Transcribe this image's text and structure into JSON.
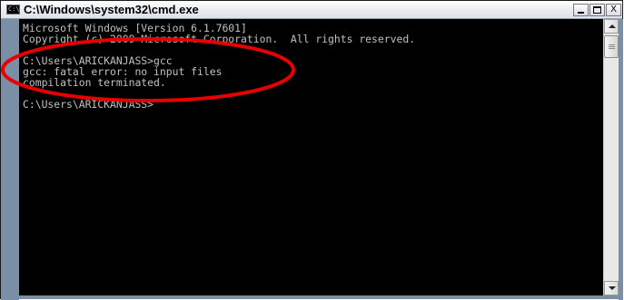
{
  "window": {
    "title": "C:\\Windows\\system32\\cmd.exe",
    "icon": "cmd-icon",
    "icon_text": "C:\\"
  },
  "controls": {
    "minimize": "minimize-icon",
    "maximize": "maximize-icon",
    "close": "close-icon",
    "close_glyph": "X"
  },
  "console": {
    "lines": [
      "Microsoft Windows [Version 6.1.7601]",
      "Copyright (c) 2009 Microsoft Corporation.  All rights reserved.",
      "",
      "C:\\Users\\ARICKANJASS>gcc",
      "gcc: fatal error: no input files",
      "compilation terminated.",
      "",
      "C:\\Users\\ARICKANJASS>"
    ]
  },
  "annotation": {
    "color": "#e60000"
  },
  "colors": {
    "console_bg": "#000000",
    "console_text": "#c0c0c0",
    "frame": "#7a8fa6"
  }
}
